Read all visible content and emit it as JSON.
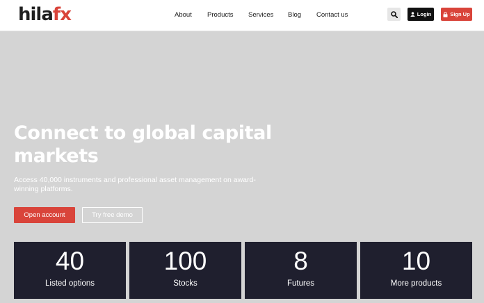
{
  "brand": {
    "name_main": "hila",
    "name_accent": "fx"
  },
  "nav": {
    "links": [
      "About",
      "Products",
      "Services",
      "Blog",
      "Contact us"
    ],
    "search_icon": "search-icon",
    "login_label": "Login",
    "signup_label": "Sign Up"
  },
  "hero": {
    "title": "Connect to global capital markets",
    "subtitle": "Access 40,000 instruments and professional asset management on award-winning platforms.",
    "primary_cta": "Open account",
    "secondary_cta": "Try free demo"
  },
  "stats": [
    {
      "value": "40",
      "label": "Listed options"
    },
    {
      "value": "100",
      "label": "Stocks"
    },
    {
      "value": "8",
      "label": "Futures"
    },
    {
      "value": "10",
      "label": "More products"
    }
  ],
  "colors": {
    "accent": "#d9443a",
    "card": "#1f1f2e",
    "hero_bg": "#d4d4d4"
  }
}
